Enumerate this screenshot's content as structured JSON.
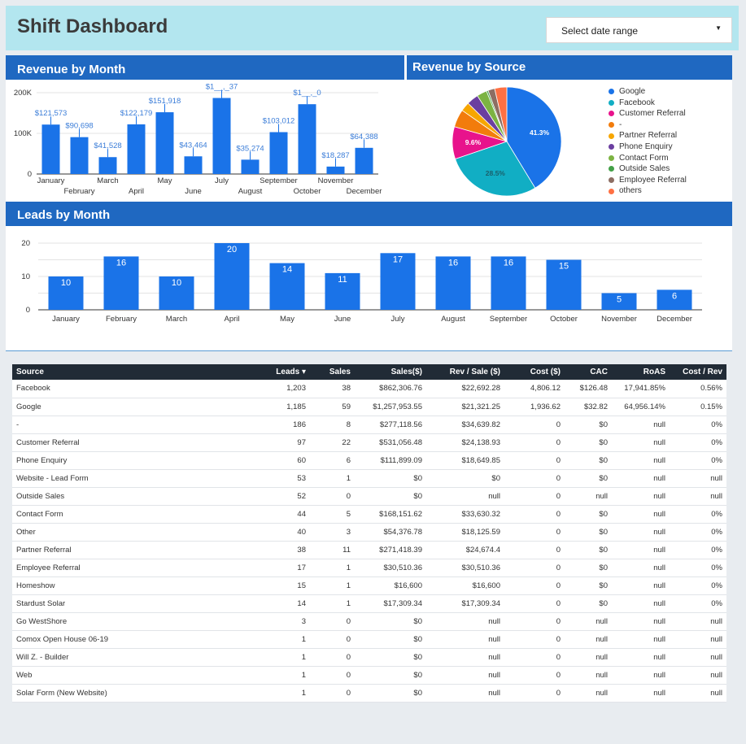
{
  "header": {
    "title": "Shift Dashboard",
    "date_range_label": "Select date range"
  },
  "panels": {
    "revenue_by_month": "Revenue by Month",
    "revenue_by_source": "Revenue by Source",
    "leads_by_month": "Leads by Month"
  },
  "chart_data": [
    {
      "type": "bar",
      "title": "Revenue by Month",
      "categories": [
        "January",
        "February",
        "March",
        "April",
        "May",
        "June",
        "July",
        "August",
        "September",
        "October",
        "November",
        "December"
      ],
      "values": [
        121573,
        90698,
        41528,
        122179,
        151918,
        43464,
        187037,
        35274,
        103012,
        171680,
        18287,
        64388
      ],
      "value_labels": [
        "$121,573",
        "$90,698",
        "$41,528",
        "$122,179",
        "$151,918",
        "$43,464",
        "$1__,_37",
        "$35,274",
        "$103,012",
        "$1__,_0",
        "$18,287",
        "$64,388"
      ],
      "yticks": [
        "0",
        "100K",
        "200K"
      ],
      "ylim": [
        0,
        200000
      ]
    },
    {
      "type": "pie",
      "title": "Revenue by Source",
      "slices": [
        {
          "name": "Google",
          "value": 41.3,
          "label": "41.3%",
          "color": "#1a73e8"
        },
        {
          "name": "Facebook",
          "value": 28.5,
          "label": "28.5%",
          "color": "#11aec4"
        },
        {
          "name": "Customer Referral",
          "value": 9.6,
          "label": "9.6%",
          "color": "#e8138c"
        },
        {
          "name": "-",
          "value": 5.3,
          "color": "#f27c0c"
        },
        {
          "name": "Partner Referral",
          "value": 2.7,
          "color": "#f7a600"
        },
        {
          "name": "Phone Enquiry",
          "value": 3.5,
          "color": "#6b3fa0"
        },
        {
          "name": "Contact Form",
          "value": 3.0,
          "color": "#7cb342"
        },
        {
          "name": "Outside Sales",
          "value": 0.5,
          "color": "#43a047"
        },
        {
          "name": "Employee Referral",
          "value": 2.0,
          "color": "#8d6e63"
        },
        {
          "name": "others",
          "value": 3.6,
          "color": "#ff7043"
        }
      ]
    },
    {
      "type": "bar",
      "title": "Leads by Month",
      "categories": [
        "January",
        "February",
        "March",
        "April",
        "May",
        "June",
        "July",
        "August",
        "September",
        "October",
        "November",
        "December"
      ],
      "values": [
        10,
        16,
        10,
        20,
        14,
        11,
        17,
        16,
        16,
        15,
        5,
        6
      ],
      "yticks": [
        "0",
        "10",
        "20"
      ],
      "ylim": [
        0,
        20
      ]
    }
  ],
  "table": {
    "columns": [
      "Source",
      "Leads ▾",
      "Sales",
      "Sales($)",
      "Rev / Sale ($)",
      "Cost ($)",
      "CAC",
      "RoAS",
      "Cost / Rev"
    ],
    "rows": [
      [
        "Facebook",
        "1,203",
        "38",
        "$862,306.76",
        "$22,692.28",
        "4,806.12",
        "$126.48",
        "17,941.85%",
        "0.56%"
      ],
      [
        "Google",
        "1,185",
        "59",
        "$1,257,953.55",
        "$21,321.25",
        "1,936.62",
        "$32.82",
        "64,956.14%",
        "0.15%"
      ],
      [
        "-",
        "186",
        "8",
        "$277,118.56",
        "$34,639.82",
        "0",
        "$0",
        "null",
        "0%"
      ],
      [
        "Customer Referral",
        "97",
        "22",
        "$531,056.48",
        "$24,138.93",
        "0",
        "$0",
        "null",
        "0%"
      ],
      [
        "Phone Enquiry",
        "60",
        "6",
        "$111,899.09",
        "$18,649.85",
        "0",
        "$0",
        "null",
        "0%"
      ],
      [
        "Website - Lead Form",
        "53",
        "1",
        "$0",
        "$0",
        "0",
        "$0",
        "null",
        "null"
      ],
      [
        "Outside Sales",
        "52",
        "0",
        "$0",
        "null",
        "0",
        "null",
        "null",
        "null"
      ],
      [
        "Contact Form",
        "44",
        "5",
        "$168,151.62",
        "$33,630.32",
        "0",
        "$0",
        "null",
        "0%"
      ],
      [
        "Other",
        "40",
        "3",
        "$54,376.78",
        "$18,125.59",
        "0",
        "$0",
        "null",
        "0%"
      ],
      [
        "Partner Referral",
        "38",
        "11",
        "$271,418.39",
        "$24,674.4",
        "0",
        "$0",
        "null",
        "0%"
      ],
      [
        "Employee Referral",
        "17",
        "1",
        "$30,510.36",
        "$30,510.36",
        "0",
        "$0",
        "null",
        "0%"
      ],
      [
        "Homeshow",
        "15",
        "1",
        "$16,600",
        "$16,600",
        "0",
        "$0",
        "null",
        "0%"
      ],
      [
        "Stardust Solar",
        "14",
        "1",
        "$17,309.34",
        "$17,309.34",
        "0",
        "$0",
        "null",
        "0%"
      ],
      [
        "Go WestShore",
        "3",
        "0",
        "$0",
        "null",
        "0",
        "null",
        "null",
        "null"
      ],
      [
        "Comox Open House 06-19",
        "1",
        "0",
        "$0",
        "null",
        "0",
        "null",
        "null",
        "null"
      ],
      [
        "Will Z. - Builder",
        "1",
        "0",
        "$0",
        "null",
        "0",
        "null",
        "null",
        "null"
      ],
      [
        "Web",
        "1",
        "0",
        "$0",
        "null",
        "0",
        "null",
        "null",
        "null"
      ],
      [
        "Solar Form (New Website)",
        "1",
        "0",
        "$0",
        "null",
        "0",
        "null",
        "null",
        "null"
      ]
    ]
  }
}
